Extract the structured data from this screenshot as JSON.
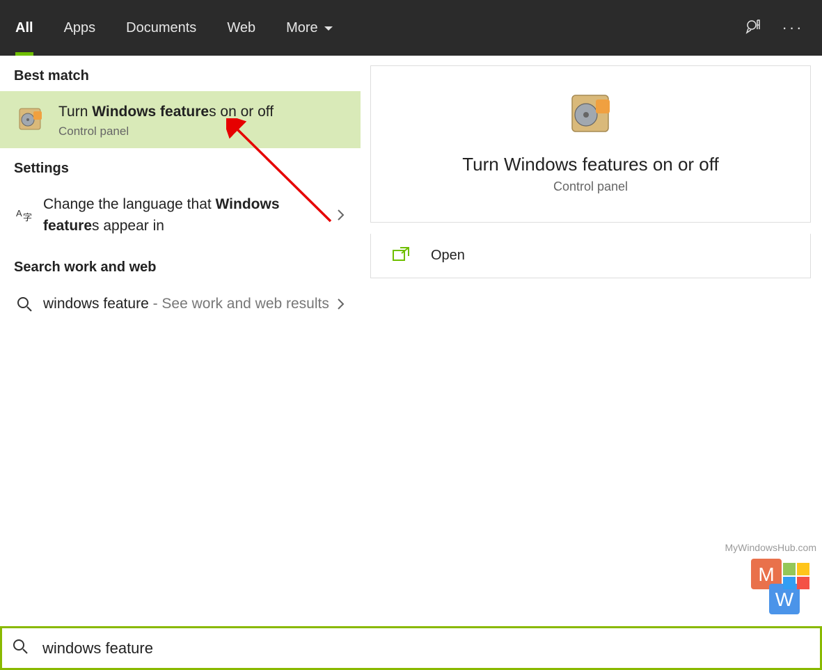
{
  "header": {
    "tabs": [
      "All",
      "Apps",
      "Documents",
      "Web",
      "More"
    ],
    "active_index": 0
  },
  "left": {
    "best_match_heading": "Best match",
    "best_match": {
      "prefix": "Turn ",
      "bold": "Windows feature",
      "suffix": "s on or off",
      "subtitle": "Control panel"
    },
    "settings_heading": "Settings",
    "setting_item": {
      "prefix": "Change the language that ",
      "bold": "Windows feature",
      "suffix": "s appear in"
    },
    "search_heading": "Search work and web",
    "web_item": {
      "query": "windows feature",
      "tail": " - See work and web results"
    }
  },
  "preview": {
    "title": "Turn Windows features on or off",
    "subtitle": "Control panel",
    "open_label": "Open"
  },
  "search": {
    "value": "windows feature"
  },
  "watermark": "MyWindowsHub.com"
}
